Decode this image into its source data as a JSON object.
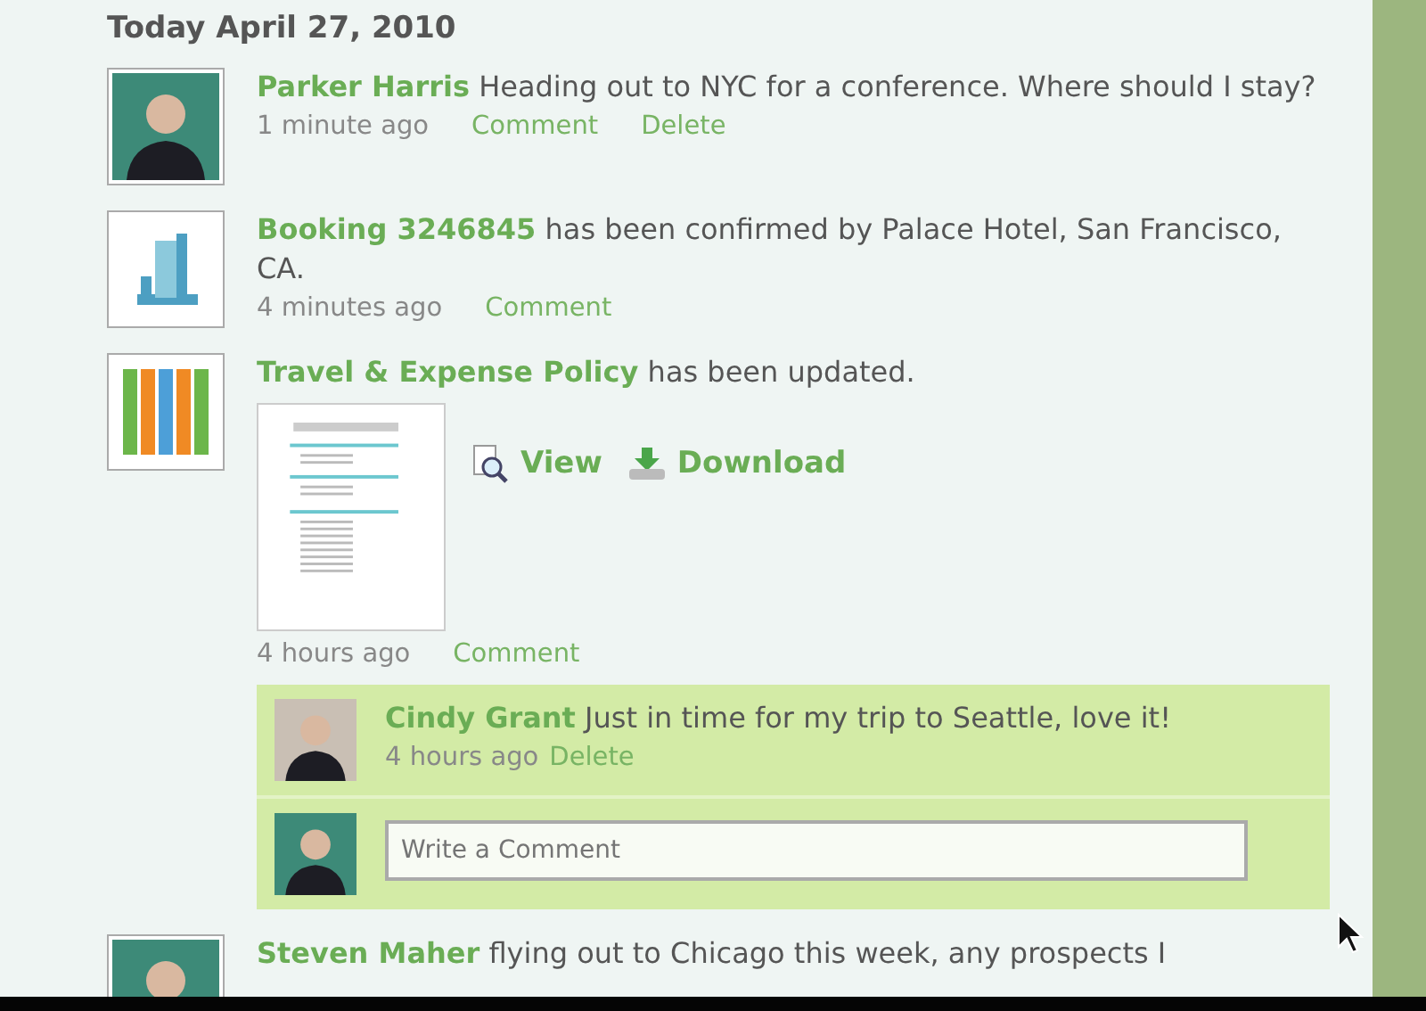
{
  "date_heading": "Today April 27, 2010",
  "feed": [
    {
      "kind": "status",
      "link": "Parker Harris",
      "text": "Heading out to NYC for a conference. Where should I stay?",
      "time": "1 minute ago",
      "actions": [
        "Comment",
        "Delete"
      ]
    },
    {
      "kind": "booking",
      "link": "Booking 3246845",
      "text": "has been confirmed by Palace Hotel, San Francisco, CA.",
      "time": "4 minutes ago",
      "actions": [
        "Comment"
      ]
    },
    {
      "kind": "document",
      "link": "Travel & Expense Policy",
      "text": "has been updated.",
      "file_actions": [
        {
          "kind": "view",
          "label": "View"
        },
        {
          "kind": "download",
          "label": "Download"
        }
      ],
      "time": "4 hours ago",
      "actions": [
        "Comment"
      ],
      "comments": [
        {
          "author": "Cindy Grant",
          "text": "Just in time for my trip to Seattle, love it!",
          "time": "4 hours ago",
          "actions": [
            "Delete"
          ]
        }
      ],
      "comment_field": {
        "placeholder": "Write a Comment"
      }
    },
    {
      "kind": "status",
      "link": "Steven Maher",
      "text": "flying out to Chicago this week, any prospects I"
    }
  ]
}
